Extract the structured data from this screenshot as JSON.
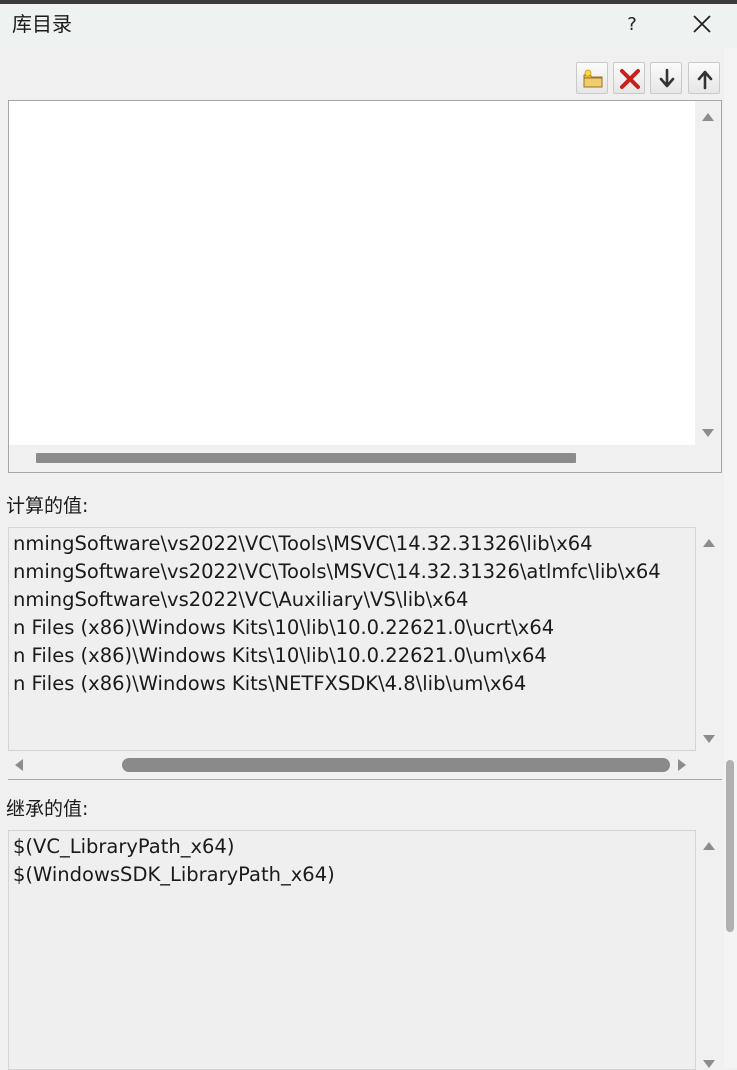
{
  "window": {
    "title": "库目录",
    "help_label": "?",
    "close_icon": "close-icon"
  },
  "toolbar": {
    "buttons": [
      {
        "name": "new-line-button",
        "icon": "new-folder-icon"
      },
      {
        "name": "delete-line-button",
        "icon": "delete-x-icon"
      },
      {
        "name": "move-down-button",
        "icon": "arrow-down-icon"
      },
      {
        "name": "move-up-button",
        "icon": "arrow-up-icon"
      }
    ]
  },
  "edit_list": {
    "items": []
  },
  "computed": {
    "label": "计算的值:",
    "lines": [
      "nmingSoftware\\vs2022\\VC\\Tools\\MSVC\\14.32.31326\\lib\\x64",
      "nmingSoftware\\vs2022\\VC\\Tools\\MSVC\\14.32.31326\\atlmfc\\lib\\x64",
      "nmingSoftware\\vs2022\\VC\\Auxiliary\\VS\\lib\\x64",
      "n Files (x86)\\Windows Kits\\10\\lib\\10.0.22621.0\\ucrt\\x64",
      "n Files (x86)\\Windows Kits\\10\\lib\\10.0.22621.0\\um\\x64",
      "n Files (x86)\\Windows Kits\\NETFXSDK\\4.8\\lib\\um\\x64"
    ]
  },
  "inherited": {
    "label": "继承的值:",
    "lines": [
      "$(VC_LibraryPath_x64)",
      "$(WindowsSDK_LibraryPath_x64)"
    ]
  },
  "colors": {
    "background": "#f0f0f0",
    "titlebar": "#eef2f1",
    "delete_red": "#c8201a",
    "folder_yellow": "#e8b84a"
  }
}
